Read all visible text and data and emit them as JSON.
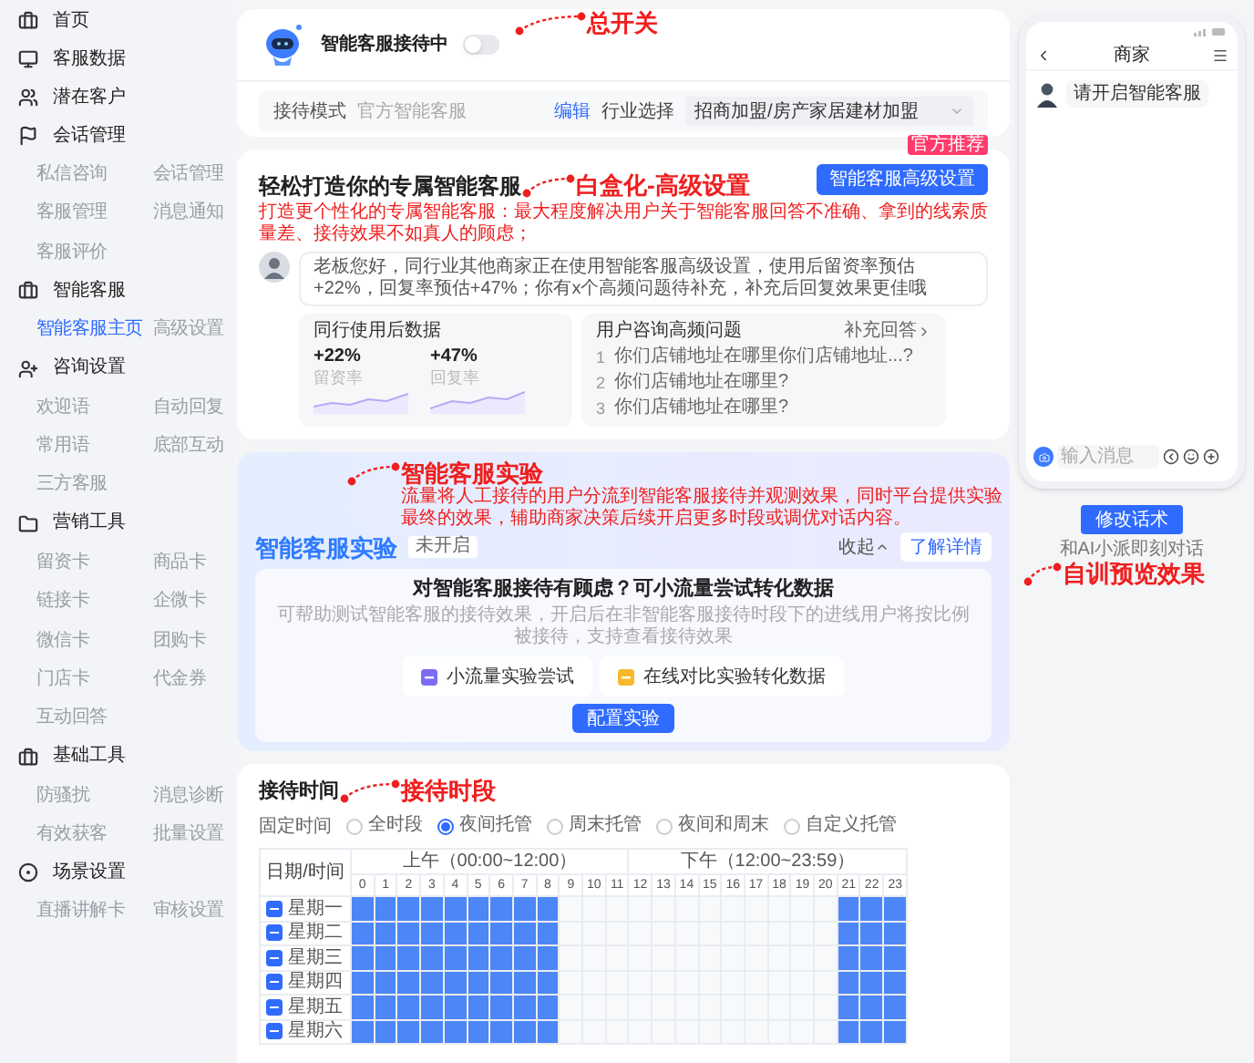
{
  "sidebar": {
    "groups": [
      {
        "title": "首页"
      },
      {
        "title": "客服数据"
      },
      {
        "title": "潜在客户"
      },
      {
        "title": "会话管理",
        "items": [
          {
            "label": "私信咨询",
            "selected": false
          },
          {
            "label": "会话管理",
            "selected": false
          },
          {
            "label": "客服管理",
            "selected": false
          },
          {
            "label": "消息通知",
            "selected": false
          },
          {
            "label": "客服评价",
            "selected": false
          }
        ]
      },
      {
        "title": "智能客服",
        "items": [
          {
            "label": "智能客服主页",
            "selected": true
          },
          {
            "label": "高级设置",
            "selected": false
          }
        ]
      },
      {
        "title": "咨询设置",
        "items": [
          {
            "label": "欢迎语",
            "selected": false
          },
          {
            "label": "自动回复",
            "selected": false
          },
          {
            "label": "常用语",
            "selected": false
          },
          {
            "label": "底部互动",
            "selected": false
          },
          {
            "label": "三方客服",
            "selected": false
          }
        ]
      },
      {
        "title": "营销工具",
        "items": [
          {
            "label": "留资卡",
            "selected": false
          },
          {
            "label": "商品卡",
            "selected": false
          },
          {
            "label": "链接卡",
            "selected": false
          },
          {
            "label": "企微卡",
            "selected": false
          },
          {
            "label": "微信卡",
            "selected": false
          },
          {
            "label": "团购卡",
            "selected": false
          },
          {
            "label": "门店卡",
            "selected": false
          },
          {
            "label": "代金券",
            "selected": false
          },
          {
            "label": "互动回答",
            "selected": false
          }
        ]
      },
      {
        "title": "基础工具",
        "items": [
          {
            "label": "防骚扰",
            "selected": false
          },
          {
            "label": "消息诊断",
            "selected": false
          },
          {
            "label": "有效获客",
            "selected": false
          },
          {
            "label": "批量设置",
            "selected": false
          }
        ]
      },
      {
        "title": "场景设置",
        "items": [
          {
            "label": "直播讲解卡",
            "selected": false
          },
          {
            "label": "审核设置",
            "selected": false
          }
        ]
      }
    ]
  },
  "reception": {
    "annotation": {
      "title": "总开关"
    },
    "title": "智能客服接待中",
    "switch": {
      "on": false
    },
    "mode_label": "接待模式",
    "mode_value": "官方智能客服",
    "edit_link": "编辑",
    "industry_label": "行业选择",
    "industry_select": {
      "value": "招商加盟/房产家居建材加盟"
    }
  },
  "advanced": {
    "annotation": {
      "title": "白盒化-高级设置",
      "text": "打造更个性化的专属智能客服：最大程度解决用户关于智能客服回答不准确、拿到的线索质量差、接待效果不如真人的顾虑；"
    },
    "title": "轻松打造你的专属智能客服",
    "button": "智能客服高级设置",
    "badge": "官方推荐",
    "message": "老板您好，同行业其他商家正在使用智能客服高级设置，使用后留资率预估+22%，回复率预估+47%；你有x个高频问题待补充，补充后回复效果更佳哦",
    "stats": {
      "title": "同行使用后数据",
      "items": [
        {
          "value": "+22%",
          "label": "留资率"
        },
        {
          "value": "+47%",
          "label": "回复率"
        }
      ]
    },
    "faq": {
      "title": "用户咨询高频问题",
      "link": "补充回答",
      "items": [
        {
          "index": "1",
          "text": "你们店铺地址在哪里你们店铺地址...?"
        },
        {
          "index": "2",
          "text": "你们店铺地址在哪里?"
        },
        {
          "index": "3",
          "text": "你们店铺地址在哪里?"
        }
      ]
    }
  },
  "experiment": {
    "annotation": {
      "title": "智能客服实验",
      "text": "流量将人工接待的用户分流到智能客服接待并观测效果，同时平台提供实验最终的效果，辅助商家决策后续开启更多时段或调优对话内容。"
    },
    "title": "智能客服实验",
    "status": "未开启",
    "collapse": "收起",
    "details_button": "了解详情",
    "heading": "对智能客服接待有顾虑？可小流量尝试转化数据",
    "description": "可帮助测试智能客服的接待效果，开启后在非智能客服接待时段下的进线用户将按比例被接待，支持查看接待效果",
    "features": [
      {
        "label": "小流量实验尝试",
        "color": "#7b6cf2"
      },
      {
        "label": "在线对比实验转化数据",
        "color": "#f6b92b"
      }
    ],
    "configure_button": "配置实验"
  },
  "schedule": {
    "annotation": {
      "title": "接待时段"
    },
    "title": "接待时间",
    "mode_label": "固定时间",
    "modes": [
      {
        "label": "全时段",
        "selected": false
      },
      {
        "label": "夜间托管",
        "selected": true
      },
      {
        "label": "周末托管",
        "selected": false
      },
      {
        "label": "夜间和周末",
        "selected": false
      },
      {
        "label": "自定义托管",
        "selected": false
      }
    ],
    "table": {
      "corner": "日期/时间",
      "groups": [
        "上午（00:00~12:00）",
        "下午（12:00~23:59）"
      ],
      "hours": [
        "0",
        "1",
        "2",
        "3",
        "4",
        "5",
        "6",
        "7",
        "8",
        "9",
        "10",
        "11",
        "12",
        "13",
        "14",
        "15",
        "16",
        "17",
        "18",
        "19",
        "20",
        "21",
        "22",
        "23"
      ],
      "rows": [
        {
          "day": "星期一",
          "partial": true,
          "slots": [
            true,
            true,
            true,
            true,
            true,
            true,
            true,
            true,
            true,
            false,
            false,
            false,
            false,
            false,
            false,
            false,
            false,
            false,
            false,
            false,
            false,
            true,
            true,
            true
          ]
        },
        {
          "day": "星期二",
          "partial": true,
          "slots": [
            true,
            true,
            true,
            true,
            true,
            true,
            true,
            true,
            true,
            false,
            false,
            false,
            false,
            false,
            false,
            false,
            false,
            false,
            false,
            false,
            false,
            true,
            true,
            true
          ]
        },
        {
          "day": "星期三",
          "partial": true,
          "slots": [
            true,
            true,
            true,
            true,
            true,
            true,
            true,
            true,
            true,
            false,
            false,
            false,
            false,
            false,
            false,
            false,
            false,
            false,
            false,
            false,
            false,
            true,
            true,
            true
          ]
        },
        {
          "day": "星期四",
          "partial": true,
          "slots": [
            true,
            true,
            true,
            true,
            true,
            true,
            true,
            true,
            true,
            false,
            false,
            false,
            false,
            false,
            false,
            false,
            false,
            false,
            false,
            false,
            false,
            true,
            true,
            true
          ]
        },
        {
          "day": "星期五",
          "partial": true,
          "slots": [
            true,
            true,
            true,
            true,
            true,
            true,
            true,
            true,
            true,
            false,
            false,
            false,
            false,
            false,
            false,
            false,
            false,
            false,
            false,
            false,
            false,
            true,
            true,
            true
          ]
        },
        {
          "day": "星期六",
          "partial": true,
          "slots": [
            true,
            true,
            true,
            true,
            true,
            true,
            true,
            true,
            true,
            false,
            false,
            false,
            false,
            false,
            false,
            false,
            false,
            false,
            false,
            false,
            false,
            true,
            true,
            true
          ]
        }
      ]
    }
  },
  "phone": {
    "title": "商家",
    "message": "请开启智能客服",
    "input_placeholder": "输入消息",
    "edit_button": "修改话术",
    "hint": "和AI小派即刻对话",
    "annotation": {
      "title": "自训预览效果"
    }
  }
}
